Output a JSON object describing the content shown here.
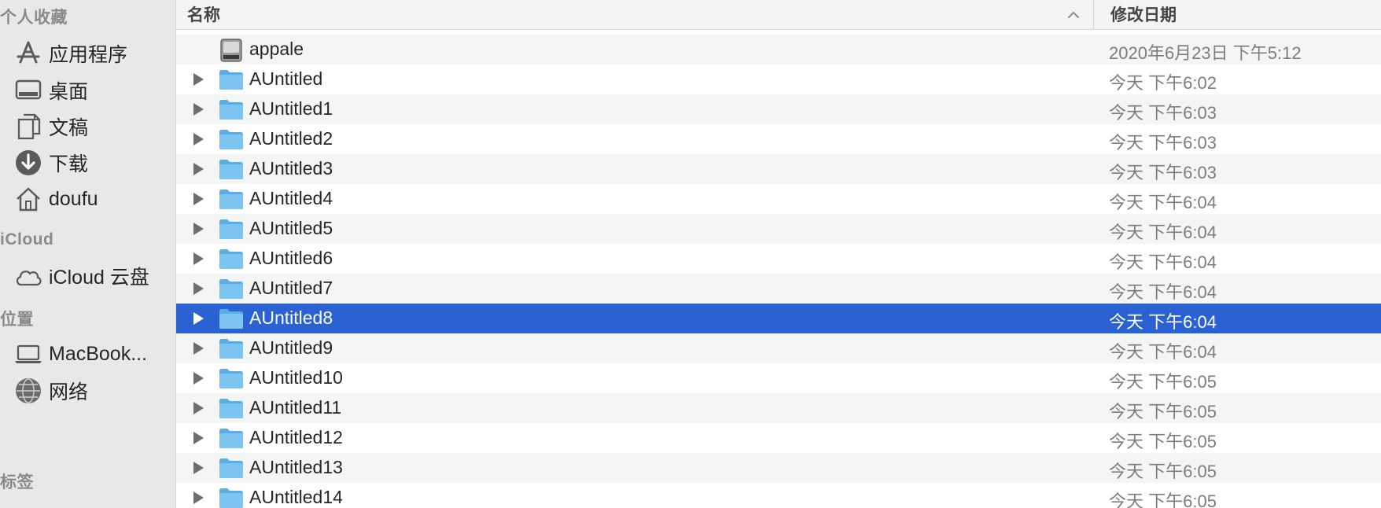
{
  "sidebar": {
    "favorites_header": "个人收藏",
    "favorites": [
      {
        "label": "应用程序",
        "icon": "applications-icon"
      },
      {
        "label": "桌面",
        "icon": "desktop-icon"
      },
      {
        "label": "文稿",
        "icon": "documents-icon"
      },
      {
        "label": "下载",
        "icon": "downloads-icon"
      },
      {
        "label": "doufu",
        "icon": "home-icon"
      }
    ],
    "icloud_header": "iCloud",
    "icloud": [
      {
        "label": "iCloud 云盘",
        "icon": "cloud-icon"
      }
    ],
    "locations_header": "位置",
    "locations": [
      {
        "label": "MacBook...",
        "icon": "laptop-icon"
      },
      {
        "label": "网络",
        "icon": "network-globe-icon"
      }
    ],
    "tags_header": "标签"
  },
  "columns": {
    "name": "名称",
    "date": "修改日期",
    "sort_icon": "chevron-up-icon"
  },
  "rows": [
    {
      "name": "appale",
      "date": "2020年6月23日 下午5:12",
      "kind": "disk-image",
      "expandable": false
    },
    {
      "name": "AUntitled",
      "date": "今天 下午6:02",
      "kind": "folder",
      "expandable": true
    },
    {
      "name": "AUntitled1",
      "date": "今天 下午6:03",
      "kind": "folder",
      "expandable": true
    },
    {
      "name": "AUntitled2",
      "date": "今天 下午6:03",
      "kind": "folder",
      "expandable": true
    },
    {
      "name": "AUntitled3",
      "date": "今天 下午6:03",
      "kind": "folder",
      "expandable": true
    },
    {
      "name": "AUntitled4",
      "date": "今天 下午6:04",
      "kind": "folder",
      "expandable": true
    },
    {
      "name": "AUntitled5",
      "date": "今天 下午6:04",
      "kind": "folder",
      "expandable": true
    },
    {
      "name": "AUntitled6",
      "date": "今天 下午6:04",
      "kind": "folder",
      "expandable": true
    },
    {
      "name": "AUntitled7",
      "date": "今天 下午6:04",
      "kind": "folder",
      "expandable": true
    },
    {
      "name": "AUntitled8",
      "date": "今天 下午6:04",
      "kind": "folder",
      "expandable": true,
      "selected": true
    },
    {
      "name": "AUntitled9",
      "date": "今天 下午6:04",
      "kind": "folder",
      "expandable": true
    },
    {
      "name": "AUntitled10",
      "date": "今天 下午6:05",
      "kind": "folder",
      "expandable": true
    },
    {
      "name": "AUntitled11",
      "date": "今天 下午6:05",
      "kind": "folder",
      "expandable": true
    },
    {
      "name": "AUntitled12",
      "date": "今天 下午6:05",
      "kind": "folder",
      "expandable": true
    },
    {
      "name": "AUntitled13",
      "date": "今天 下午6:05",
      "kind": "folder",
      "expandable": true
    },
    {
      "name": "AUntitled14",
      "date": "今天 下午6:05",
      "kind": "folder",
      "expandable": true
    }
  ],
  "colors": {
    "selection": "#2a62d4",
    "folder": "#7ec4f0",
    "sidebar_bg": "#e9e8e9"
  }
}
